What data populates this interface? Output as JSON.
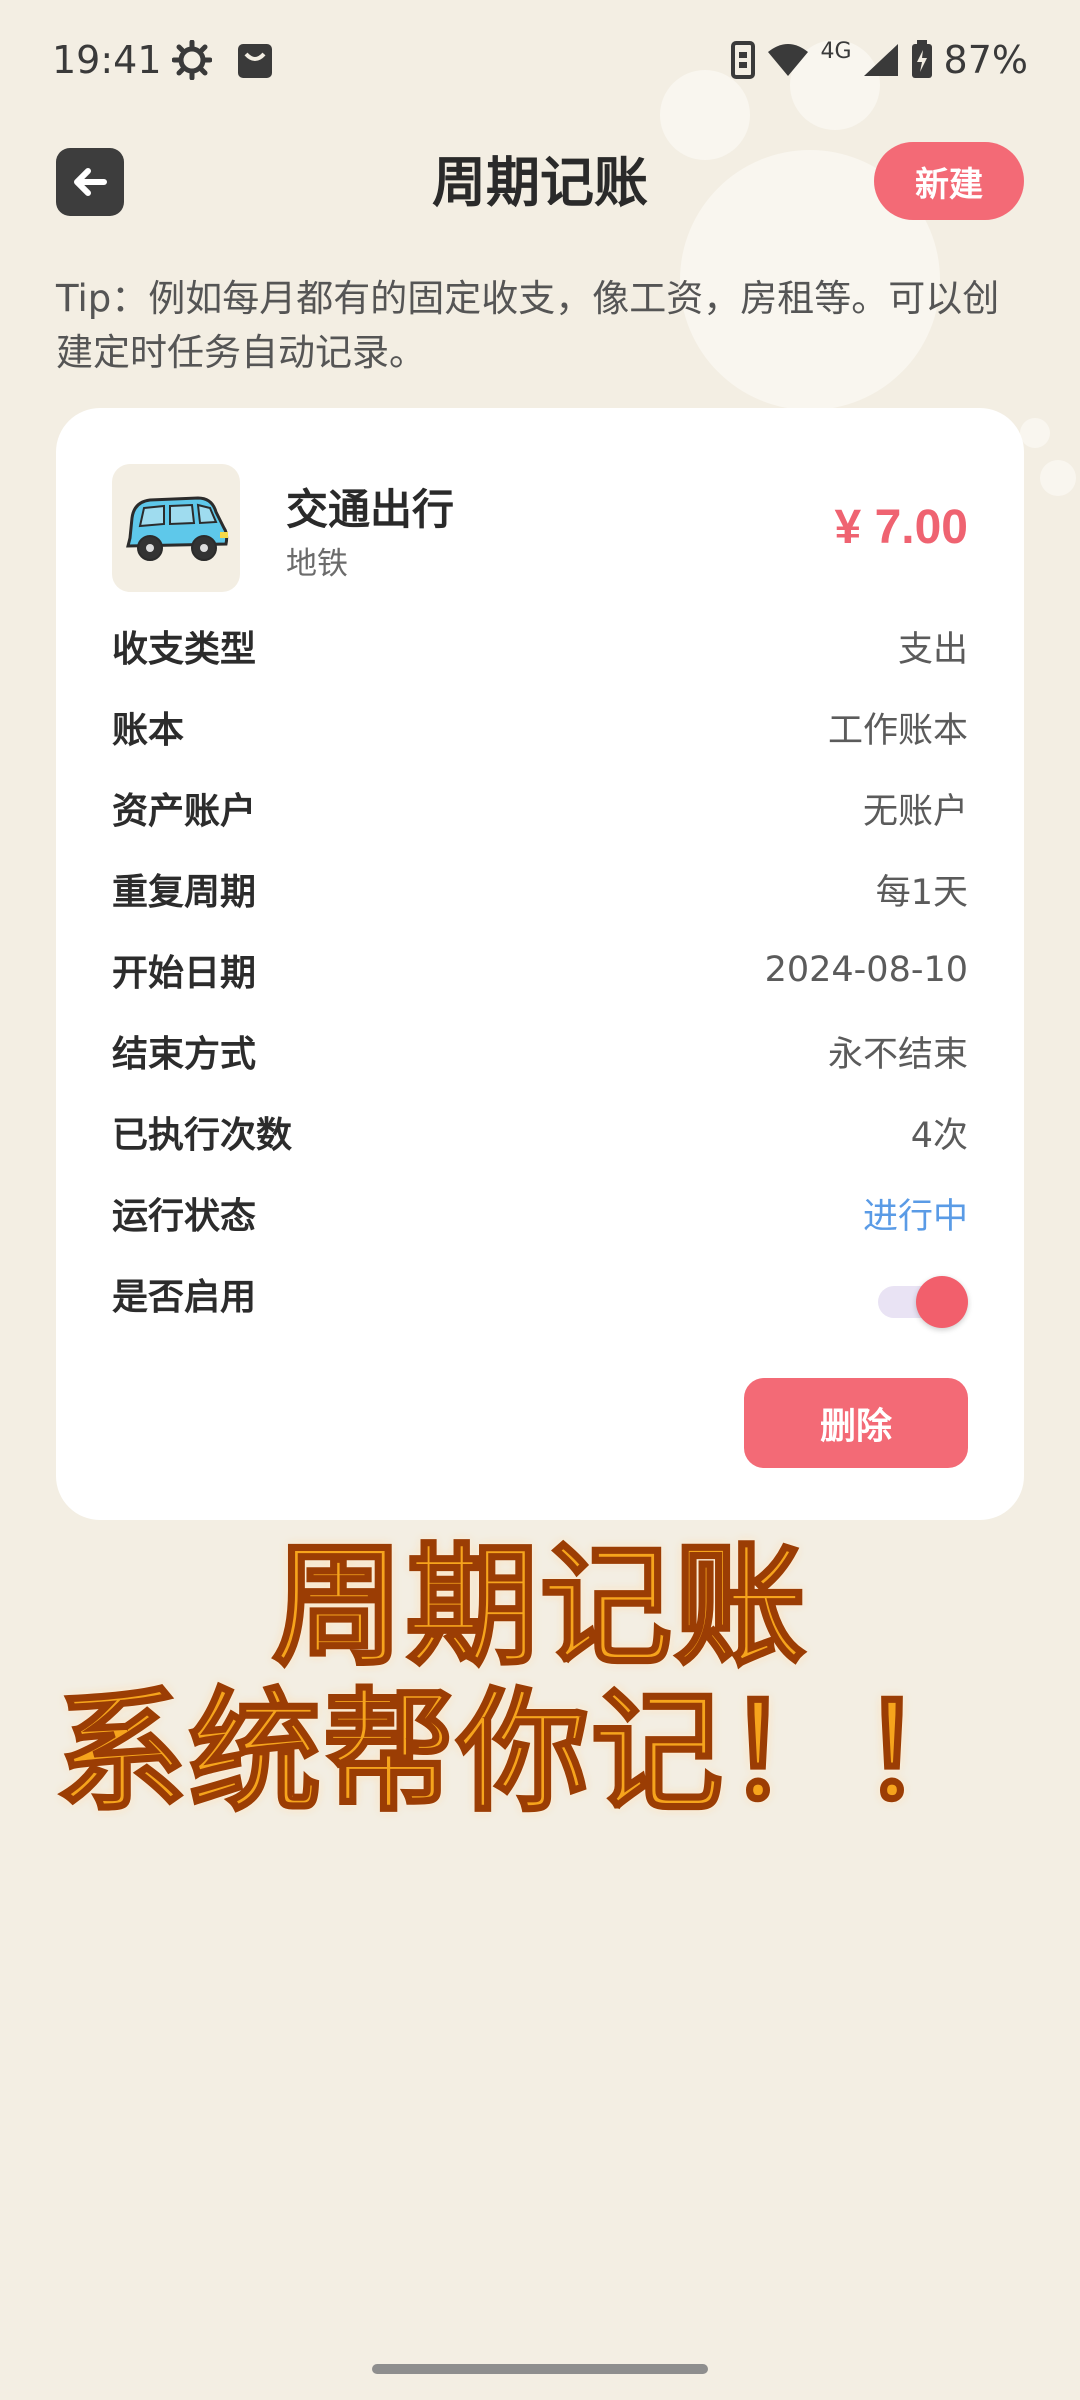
{
  "status_bar": {
    "time": "19:41",
    "battery": "87%",
    "network": "4G"
  },
  "header": {
    "title": "周期记账",
    "new_button": "新建"
  },
  "tip": "Tip：例如每月都有的固定收支，像工资，房租等。可以创建定时任务自动记录。",
  "record": {
    "category": "交通出行",
    "note": "地铁",
    "amount": "¥ 7.00",
    "icon": "car-icon",
    "rows": [
      {
        "label": "收支类型",
        "value": "支出"
      },
      {
        "label": "账本",
        "value": "工作账本"
      },
      {
        "label": "资产账户",
        "value": "无账户"
      },
      {
        "label": "重复周期",
        "value": "每1天"
      },
      {
        "label": "开始日期",
        "value": "2024-08-10"
      },
      {
        "label": "结束方式",
        "value": "永不结束"
      },
      {
        "label": "已执行次数",
        "value": "4次"
      },
      {
        "label": "运行状态",
        "value": "进行中"
      },
      {
        "label": "是否启用",
        "value": ""
      }
    ],
    "enabled": true,
    "delete_button": "删除"
  },
  "overlay_caption": {
    "line1": "周期记账",
    "line2": "系统帮你记！！"
  },
  "colors": {
    "accent": "#f36a76",
    "status_blue": "#5a9be6",
    "background": "#f3eee3"
  }
}
